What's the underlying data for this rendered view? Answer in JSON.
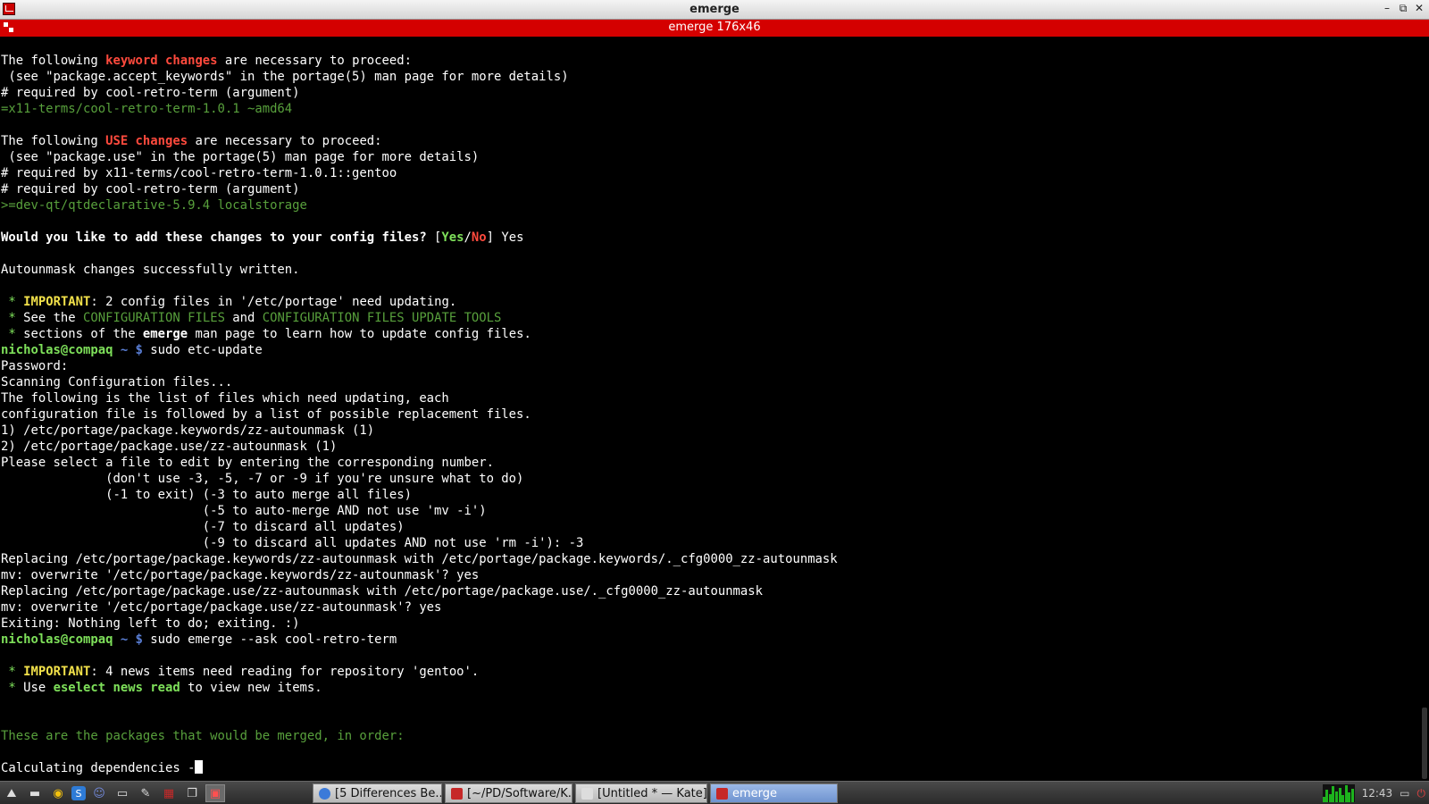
{
  "window": {
    "title": "emerge",
    "tab_title": "emerge 176x46",
    "controls": {
      "minimize": "–",
      "maximize": "⧉",
      "close": "✕"
    }
  },
  "terminal": {
    "lines": [
      "",
      "The following keyword changes are necessary to proceed:",
      " (see \"package.accept_keywords\" in the portage(5) man page for more details)",
      "# required by cool-retro-term (argument)",
      "=x11-terms/cool-retro-term-1.0.1 ~amd64",
      "",
      "The following USE changes are necessary to proceed:",
      " (see \"package.use\" in the portage(5) man page for more details)",
      "# required by x11-terms/cool-retro-term-1.0.1::gentoo",
      "# required by cool-retro-term (argument)",
      ">=dev-qt/qtdeclarative-5.9.4 localstorage",
      "",
      "Would you like to add these changes to your config files? [Yes/No] Yes",
      "",
      "Autounmask changes successfully written.",
      "",
      " * IMPORTANT: 2 config files in '/etc/portage' need updating.",
      " * See the CONFIGURATION FILES and CONFIGURATION FILES UPDATE TOOLS",
      " * sections of the emerge man page to learn how to update config files.",
      "nicholas@compaq ~ $ sudo etc-update",
      "Password:",
      "Scanning Configuration files...",
      "The following is the list of files which need updating, each",
      "configuration file is followed by a list of possible replacement files.",
      "1) /etc/portage/package.keywords/zz-autounmask (1)",
      "2) /etc/portage/package.use/zz-autounmask (1)",
      "Please select a file to edit by entering the corresponding number.",
      "              (don't use -3, -5, -7 or -9 if you're unsure what to do)",
      "              (-1 to exit) (-3 to auto merge all files)",
      "                           (-5 to auto-merge AND not use 'mv -i')",
      "                           (-7 to discard all updates)",
      "                           (-9 to discard all updates AND not use 'rm -i'): -3",
      "Replacing /etc/portage/package.keywords/zz-autounmask with /etc/portage/package.keywords/._cfg0000_zz-autounmask",
      "mv: overwrite '/etc/portage/package.keywords/zz-autounmask'? yes",
      "Replacing /etc/portage/package.use/zz-autounmask with /etc/portage/package.use/._cfg0000_zz-autounmask",
      "mv: overwrite '/etc/portage/package.use/zz-autounmask'? yes",
      "Exiting: Nothing left to do; exiting. :)",
      "nicholas@compaq ~ $ sudo emerge --ask cool-retro-term",
      "",
      " * IMPORTANT: 4 news items need reading for repository 'gentoo'.",
      " * Use eselect news read to view new items.",
      "",
      "",
      "These are the packages that would be merged, in order:",
      "",
      "Calculating dependencies -"
    ]
  },
  "taskbar": {
    "launchers": [
      {
        "name": "menu-launcher",
        "glyph": "⛰"
      },
      {
        "name": "terminal-launcher",
        "glyph": "▬"
      },
      {
        "name": "chrome-launcher",
        "glyph": "◉"
      },
      {
        "name": "skype-launcher",
        "glyph": "S"
      },
      {
        "name": "discord-launcher",
        "glyph": "☺"
      },
      {
        "name": "files-launcher",
        "glyph": "▭"
      },
      {
        "name": "editor-launcher",
        "glyph": "✎"
      },
      {
        "name": "apps-launcher",
        "glyph": "▦"
      },
      {
        "name": "windows-launcher",
        "glyph": "❐"
      },
      {
        "name": "konsole-launcher",
        "glyph": "▣"
      }
    ],
    "tasks": [
      {
        "label": "[5 Differences Be...",
        "icon_color": "#3b7ad9",
        "active": false,
        "width": 145
      },
      {
        "label": "[~/PD/Software/K...",
        "icon_color": "#c62828",
        "active": false,
        "width": 143
      },
      {
        "label": "[Untitled * — Kate]",
        "icon_color": "#dddddd",
        "active": false,
        "width": 148
      },
      {
        "label": "emerge",
        "icon_color": "#c62828",
        "active": true,
        "width": 143
      }
    ],
    "clock": "12:43"
  }
}
